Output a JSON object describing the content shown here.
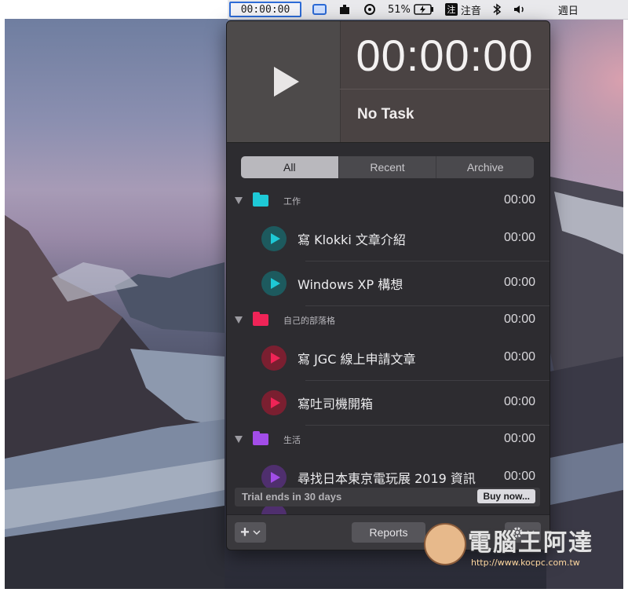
{
  "menubar": {
    "timer": "00:00:00",
    "battery": "51%",
    "ime_label": "注音",
    "ime_badge": "注",
    "clock_text": "週日"
  },
  "app": {
    "big_timer": "00:00:00",
    "current_task": "No Task",
    "tabs": [
      {
        "label": "All",
        "active": true
      },
      {
        "label": "Recent",
        "active": false
      },
      {
        "label": "Archive",
        "active": false
      }
    ],
    "groups": [
      {
        "name": "工作",
        "color": "#1ec9d6",
        "time": "00:00",
        "tasks": [
          {
            "name": "寫 Klokki 文章介紹",
            "time": "00:00"
          },
          {
            "name": "Windows XP 構想",
            "time": "00:00"
          }
        ]
      },
      {
        "name": "自己的部落格",
        "color": "#ef2457",
        "time": "00:00",
        "tasks": [
          {
            "name": "寫 JGC 線上申請文章",
            "time": "00:00"
          },
          {
            "name": "寫吐司機開箱",
            "time": "00:00"
          }
        ]
      },
      {
        "name": "生活",
        "color": "#a24de8",
        "time": "00:00",
        "tasks": [
          {
            "name": "尋找日本東京電玩展 2019 資訊",
            "time": "00:00"
          }
        ]
      }
    ],
    "task_circle_colors": [
      "#1d5a5e",
      "#7a1f30",
      "#4f2f6e"
    ],
    "trial_text": "Trial ends in 30 days",
    "buy_label": "Buy now...",
    "add_label": "+",
    "reports_label": "Reports"
  },
  "watermark": {
    "text": "電腦王阿達",
    "url": "http://www.kocpc.com.tw"
  }
}
